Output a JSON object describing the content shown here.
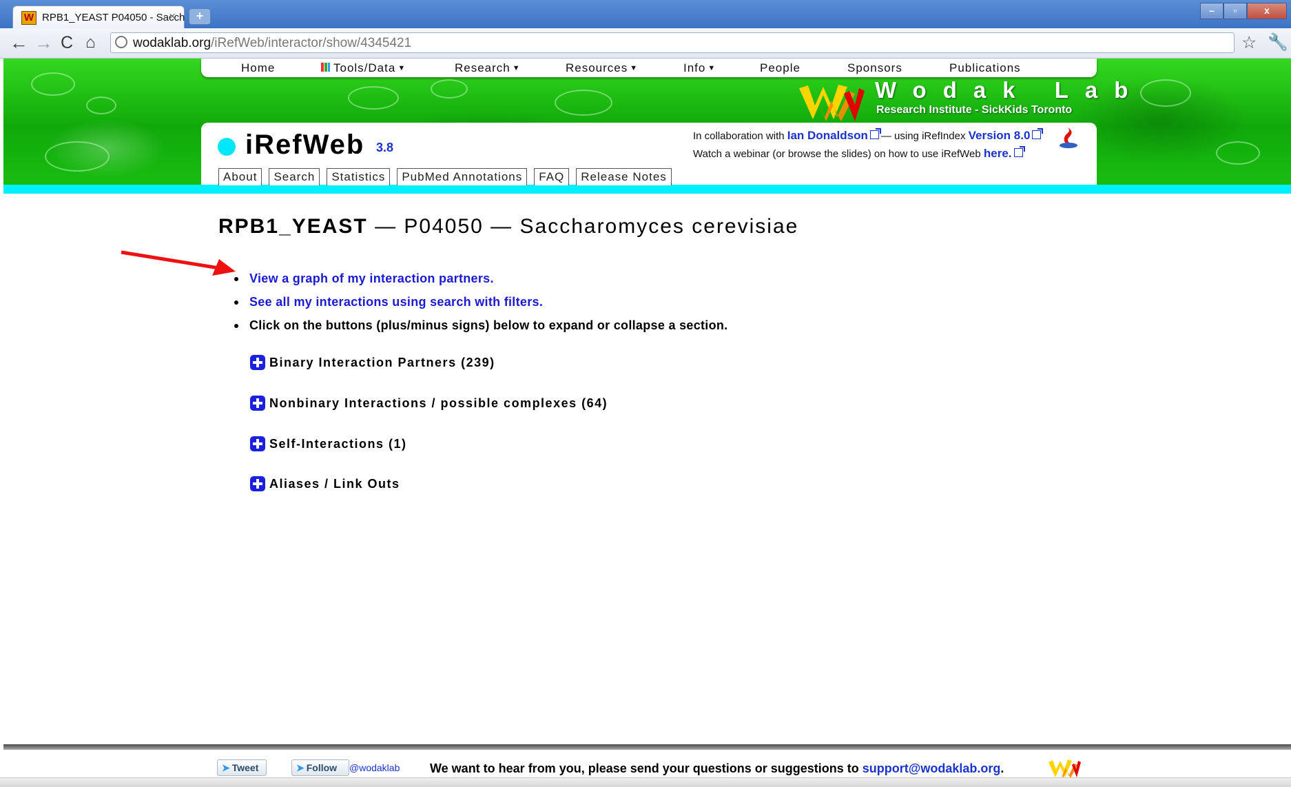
{
  "browser": {
    "tab_title": "RPB1_YEAST P04050 - Sacch",
    "tab_close": "×",
    "new_tab": "+",
    "url_host": "wodaklab.org",
    "url_path": "/iRefWeb/interactor/show/4345421",
    "window_controls": {
      "minimize": "–",
      "maximize": "▫",
      "close": "x"
    }
  },
  "site_nav": {
    "items": [
      {
        "label": "Home",
        "dropdown": false
      },
      {
        "label": "Tools/Data",
        "dropdown": true,
        "icon": "grid-icon"
      },
      {
        "label": "Research",
        "dropdown": true
      },
      {
        "label": "Resources",
        "dropdown": true
      },
      {
        "label": "Info",
        "dropdown": true
      },
      {
        "label": "People",
        "dropdown": false
      },
      {
        "label": "Sponsors",
        "dropdown": false
      },
      {
        "label": "Publications",
        "dropdown": false
      }
    ]
  },
  "lab_logo": {
    "title": "Wodak Lab",
    "subtitle": "Research Institute - SickKids Toronto",
    "colors": [
      "#ffd400",
      "#ff8a00",
      "#e00000"
    ]
  },
  "app": {
    "name": "iRefWeb",
    "version": "3.8",
    "collab_prefix": "In collaboration with",
    "collab_person": "Ian Donaldson",
    "collab_middle": "— using iRefIndex",
    "collab_version": "Version 8.0",
    "webinar_text": "Watch a webinar (or browse the slides) on how to use iRefWeb",
    "webinar_link": "here.",
    "tabs": [
      "About",
      "Search",
      "Statistics",
      "PubMed Annotations",
      "FAQ",
      "Release Notes"
    ]
  },
  "page": {
    "title_id": "RPB1_YEAST",
    "title_rest": " — P04050 — Saccharomyces cerevisiae",
    "bullets": [
      {
        "text": "View a graph of my interaction partners.",
        "link": true
      },
      {
        "text": "See all my interactions using search with filters.",
        "link": true
      },
      {
        "text": "Click on the buttons (plus/minus signs) below to expand or collapse a section.",
        "link": false
      }
    ],
    "sections": [
      "Binary Interaction Partners (239)",
      "Nonbinary Interactions / possible complexes (64)",
      "Self-Interactions (1)",
      "Aliases / Link Outs"
    ]
  },
  "footer": {
    "tweet": "Tweet",
    "follow": "Follow",
    "handle": "@wodaklab",
    "message": "We want to hear from you, please send your questions or suggestions to",
    "email": "support@wodaklab.org",
    "period": "."
  },
  "colors": {
    "accent_cyan": "#00f0ff",
    "link_blue": "#1a33cc",
    "banner_green": "#22c814",
    "annotation_arrow": "#ee1111"
  }
}
